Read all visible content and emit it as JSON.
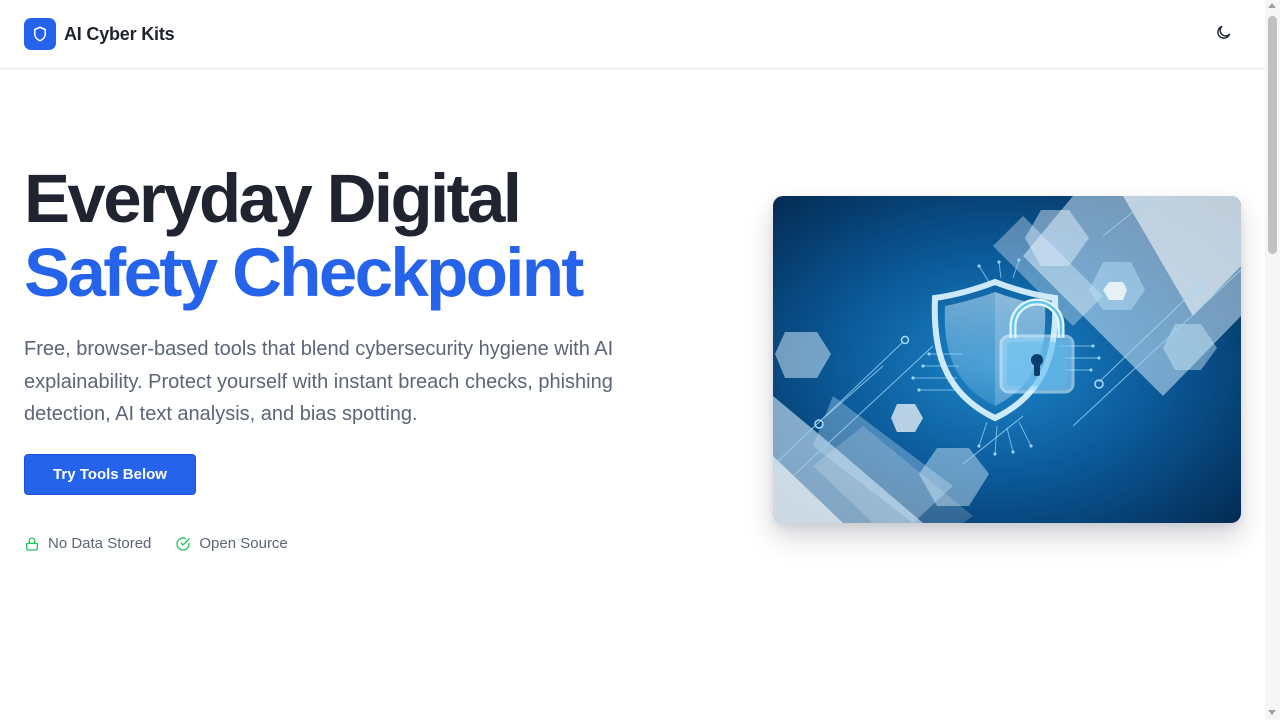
{
  "header": {
    "brand_name": "AI Cyber Kits",
    "logo_icon": "shield-icon",
    "theme_toggle_icon": "moon-icon"
  },
  "hero": {
    "title_line1": "Everyday Digital",
    "title_line2": "Safety Checkpoint",
    "description": "Free, browser-based tools that blend cybersecurity hygiene with AI explainability. Protect yourself with instant breach checks, phishing detection, AI text analysis, and bias spotting.",
    "cta_label": "Try Tools Below",
    "badges": [
      {
        "icon": "lock-icon",
        "label": "No Data Stored"
      },
      {
        "icon": "check-circle-icon",
        "label": "Open Source"
      }
    ],
    "image_subject": "shield-with-padlock-illustration"
  },
  "colors": {
    "accent": "#2563eb",
    "heading": "#1f2430",
    "body_text": "#5b6577",
    "badge_green": "#22c55e"
  }
}
